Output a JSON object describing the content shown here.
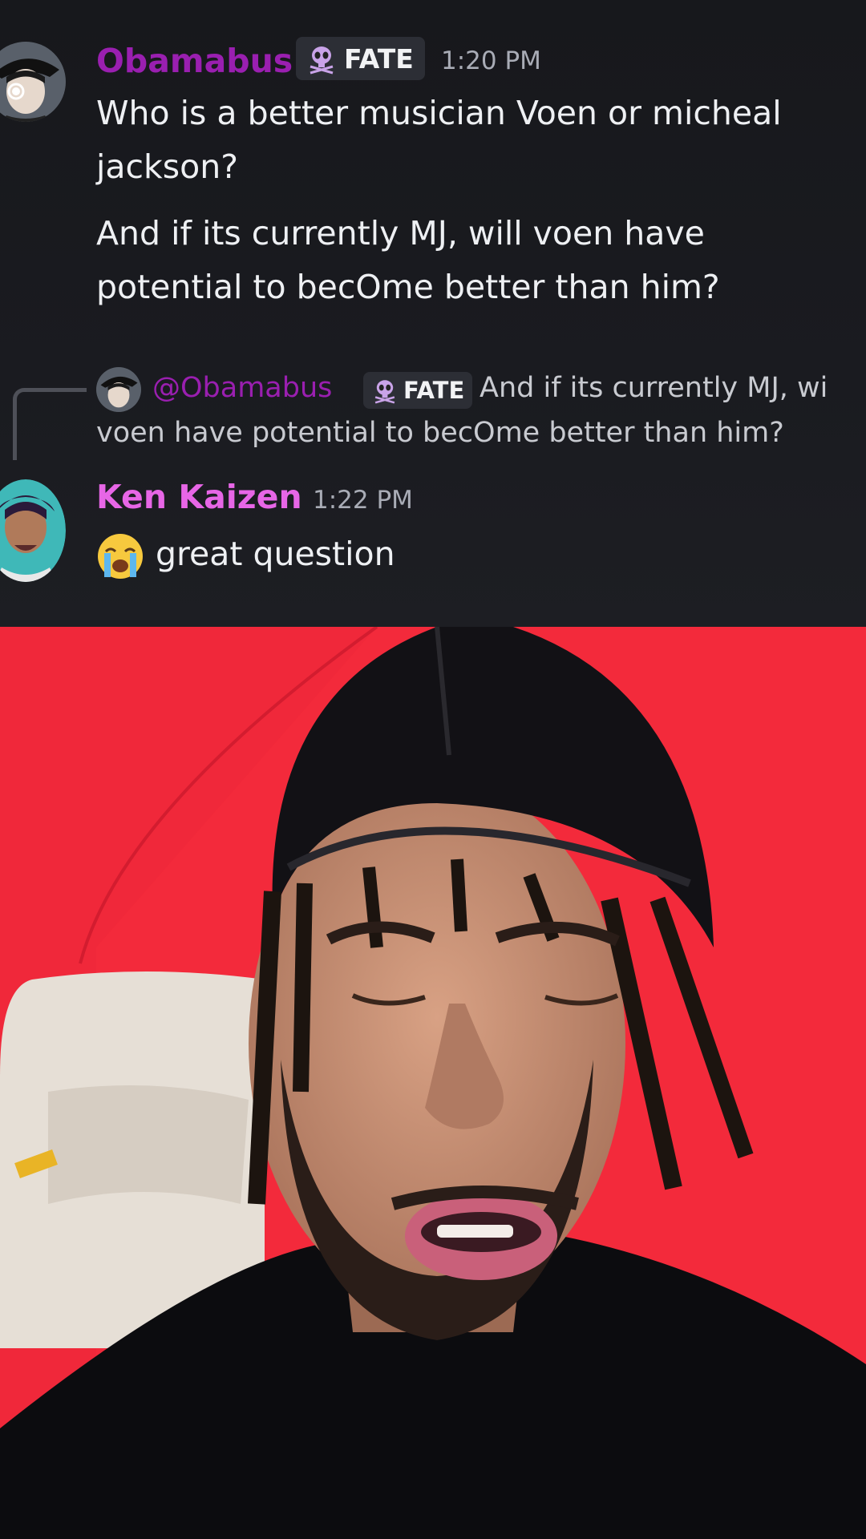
{
  "messages": [
    {
      "username": "Obamabus",
      "username_color": "#9a1fb0",
      "role": {
        "name": "FATE",
        "icon": "alien-skull-icon"
      },
      "time": "1:20 PM",
      "lines": [
        "Who is a better musician Voen or micheal",
        "jackson?"
      ],
      "followup_lines": [
        "And if its currently MJ, will voen have",
        "potential to becOme better than him?"
      ]
    },
    {
      "reply": {
        "mention": "@Obamabus",
        "role": "FATE",
        "line1": "And if its currently MJ, wi",
        "line2": "voen have potential to becOme better than him?"
      },
      "username": "Ken Kaizen",
      "username_color": "#e766e6",
      "time": "1:22 PM",
      "emoji": "loudly-crying-face-icon",
      "text": "great question"
    }
  ],
  "video": {
    "description_icon": "webcam-reaction-video"
  }
}
